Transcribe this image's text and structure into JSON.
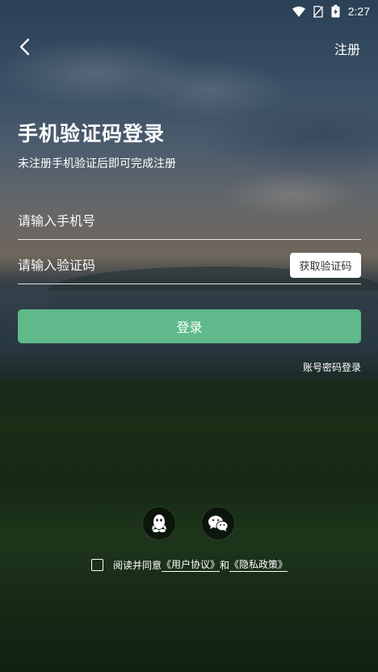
{
  "status_bar": {
    "time": "2:27",
    "icons": [
      "wifi-icon",
      "no-sim-icon",
      "battery-charging-icon"
    ]
  },
  "header": {
    "back_icon": "chevron-left-icon",
    "register_label": "注册"
  },
  "main": {
    "title": "手机验证码登录",
    "subtitle": "未注册手机验证后即可完成注册",
    "phone_placeholder": "请输入手机号",
    "phone_value": "",
    "code_placeholder": "请输入验证码",
    "code_value": "",
    "get_code_label": "获取验证码",
    "login_label": "登录",
    "password_login_label": "账号密码登录"
  },
  "social": {
    "items": [
      {
        "name": "qq",
        "icon": "qq-icon"
      },
      {
        "name": "wechat",
        "icon": "wechat-icon"
      }
    ]
  },
  "agreement": {
    "checked": false,
    "prefix": "阅读并同意",
    "user_agreement": "《用户协议》",
    "and": "和",
    "privacy_policy": "《隐私政策》"
  },
  "colors": {
    "accent": "#5fb98a",
    "text": "#ffffff"
  }
}
